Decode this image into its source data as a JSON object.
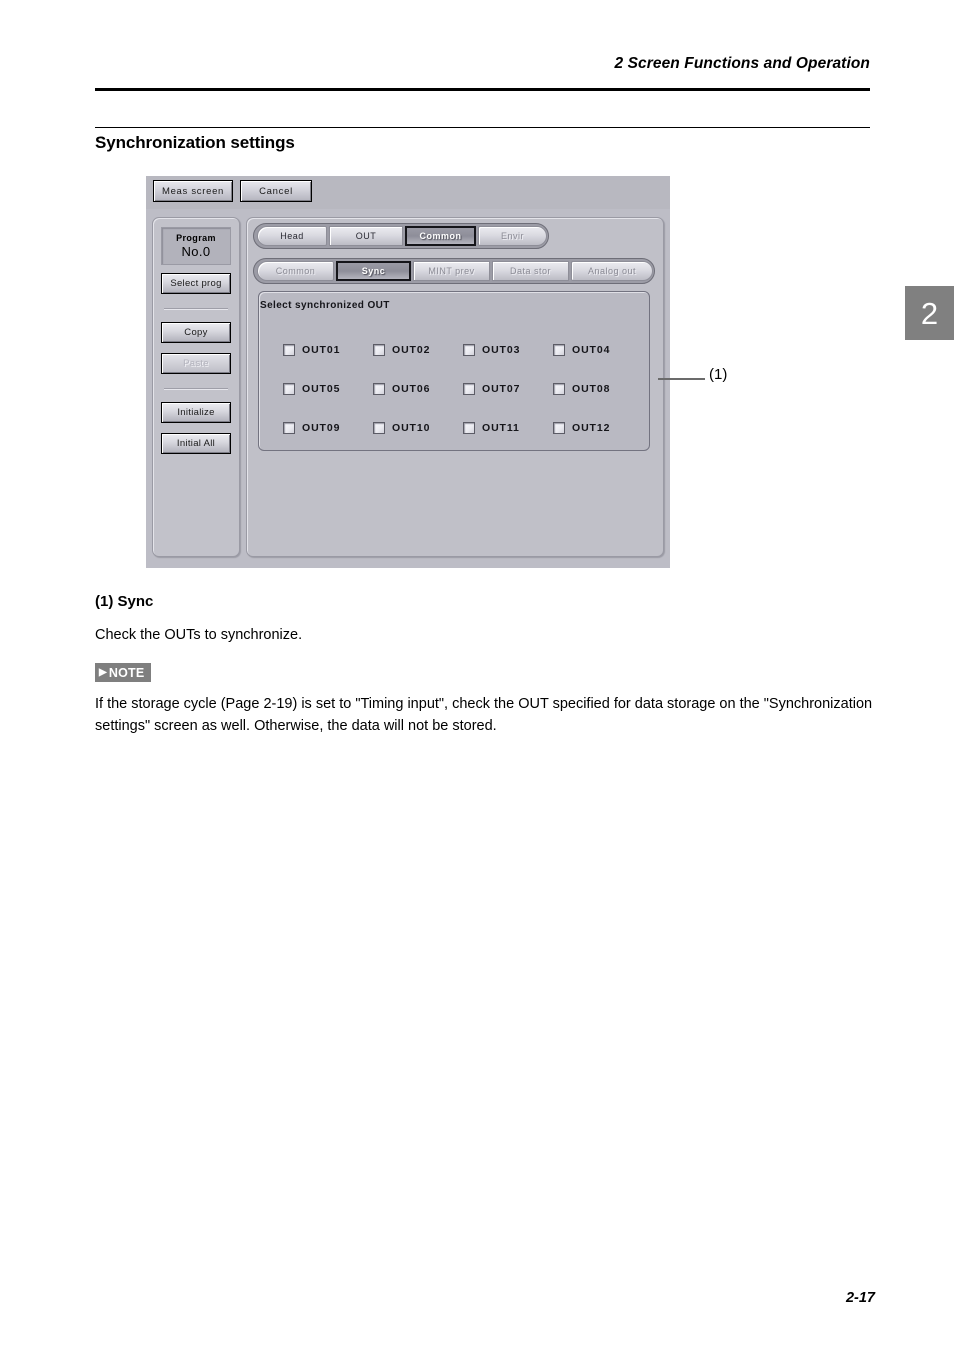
{
  "page": {
    "header_title": "2  Screen Functions and Operation",
    "section_title": "Synchronization settings",
    "chapter_marker": "2",
    "page_number": "2-17"
  },
  "device_screen": {
    "toolbar": {
      "meas_screen_label": "Meas screen",
      "cancel_label": "Cancel"
    },
    "rail": {
      "program_label": "Program",
      "program_value": "No.0",
      "buttons": [
        {
          "label": "Select prog",
          "enabled": true
        },
        {
          "label": "Copy",
          "enabled": true
        },
        {
          "label": "Paste",
          "enabled": false
        },
        {
          "label": "Initialize",
          "enabled": true
        },
        {
          "label": "Initial All",
          "enabled": true
        }
      ]
    },
    "tabs_primary": [
      {
        "label": "Head",
        "active": false,
        "dim": false
      },
      {
        "label": "OUT",
        "active": false,
        "dim": false
      },
      {
        "label": "Common",
        "active": true,
        "dim": false
      },
      {
        "label": "Envir",
        "active": false,
        "dim": true
      }
    ],
    "tabs_secondary": [
      {
        "label": "Common",
        "active": false,
        "dim": true
      },
      {
        "label": "Sync",
        "active": true,
        "dim": false
      },
      {
        "label": "MINT prev",
        "active": false,
        "dim": true
      },
      {
        "label": "Data stor",
        "active": false,
        "dim": true
      },
      {
        "label": "Analog out",
        "active": false,
        "dim": true
      }
    ],
    "group": {
      "caption": "Select synchronized OUT",
      "checkbox_rows": [
        [
          {
            "label": "OUT01",
            "checked": false
          },
          {
            "label": "OUT02",
            "checked": false
          },
          {
            "label": "OUT03",
            "checked": false
          },
          {
            "label": "OUT04",
            "checked": false
          }
        ],
        [
          {
            "label": "OUT05",
            "checked": false
          },
          {
            "label": "OUT06",
            "checked": false
          },
          {
            "label": "OUT07",
            "checked": false
          },
          {
            "label": "OUT08",
            "checked": false
          }
        ],
        [
          {
            "label": "OUT09",
            "checked": false
          },
          {
            "label": "OUT10",
            "checked": false
          },
          {
            "label": "OUT11",
            "checked": false
          },
          {
            "label": "OUT12",
            "checked": false
          }
        ]
      ]
    }
  },
  "callout": {
    "label": "(1)"
  },
  "body": {
    "subhead": "(1) Sync",
    "line_1": "Check the OUTs to synchronize.",
    "note_arrow": "▶",
    "note_badge": "NOTE",
    "note_text": "If the storage cycle (Page 2-19) is set to \"Timing input\", check the OUT specified for data storage on the \"Synchronization settings\" screen as well. Otherwise, the data will not be stored."
  },
  "colors": {
    "chrome_face": "#c0c0c8",
    "tab_track": "#9c9ca6",
    "active_tab_text": "#ffffff",
    "note_badge_bg": "#7f7f7f",
    "chapter_marker_bg": "#808080"
  }
}
